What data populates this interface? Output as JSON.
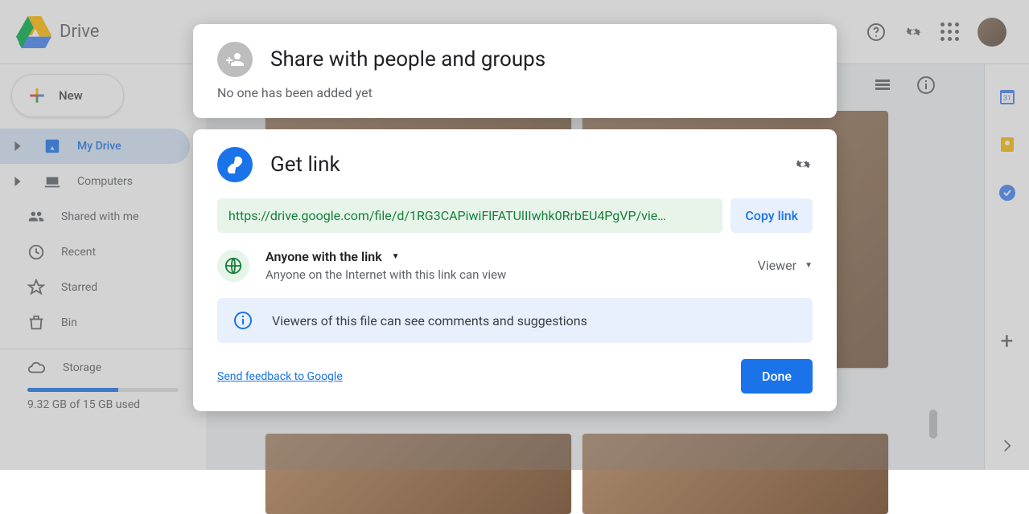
{
  "header": {
    "app_name": "Drive"
  },
  "sidebar": {
    "new_label": "New",
    "items": [
      {
        "label": "My Drive"
      },
      {
        "label": "Computers"
      },
      {
        "label": "Shared with me"
      },
      {
        "label": "Recent"
      },
      {
        "label": "Starred"
      },
      {
        "label": "Bin"
      }
    ],
    "storage": {
      "label": "Storage",
      "usage_text": "9.32 GB of 15 GB used"
    }
  },
  "share_panel": {
    "title": "Share with people and groups",
    "subtitle": "No one has been added yet"
  },
  "link_panel": {
    "title": "Get link",
    "url": "https://drive.google.com/file/d/1RG3CAPiwiFlFATUlIIwhk0RrbEU4PgVP/vie…",
    "copy_label": "Copy link",
    "access": {
      "label": "Anyone with the link",
      "description": "Anyone on the Internet with this link can view",
      "role": "Viewer"
    },
    "notice": "Viewers of this file can see comments and suggestions",
    "feedback": "Send feedback to Google",
    "done": "Done"
  }
}
